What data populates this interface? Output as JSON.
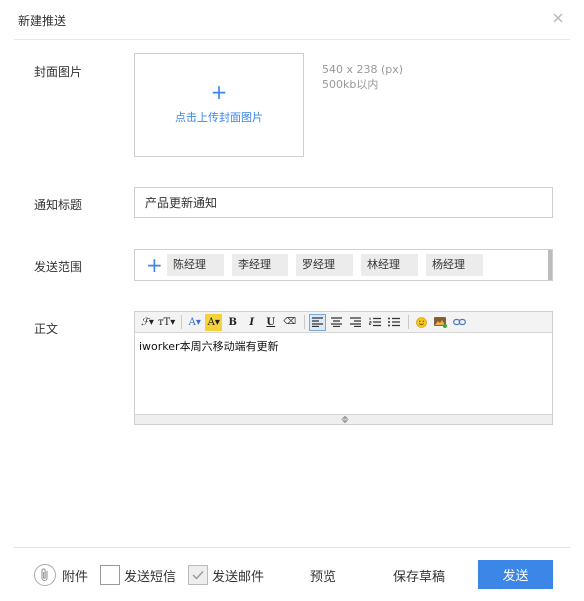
{
  "dialog": {
    "title": "新建推送"
  },
  "cover": {
    "label": "封面图片",
    "plus": "+",
    "upload_text": "点击上传封面图片",
    "hint_size": "540 x 238 (px)",
    "hint_limit": "500kb以内"
  },
  "notice_title": {
    "label": "通知标题",
    "value": "产品更新通知"
  },
  "scope": {
    "label": "发送范围",
    "add": "+",
    "recipients": [
      "陈经理",
      "李经理",
      "罗经理",
      "林经理",
      "杨经理"
    ]
  },
  "body": {
    "label": "正文",
    "content": "iworker本周六移动端有更新",
    "toolbar": {
      "font_family": "ℱ▾",
      "font_size": "ᴛT▾",
      "font_color": "A▾",
      "highlight": "A▾",
      "bold": "B",
      "italic": "I",
      "underline": "U",
      "eraser": "⌫"
    }
  },
  "footer": {
    "attachment": "附件",
    "send_sms": "发送短信",
    "send_email": "发送邮件",
    "preview": "预览",
    "save_draft": "保存草稿",
    "send": "发送"
  },
  "colors": {
    "accent": "#3b86e6",
    "chip_bg": "#ececec",
    "border": "#cfcfcf"
  }
}
